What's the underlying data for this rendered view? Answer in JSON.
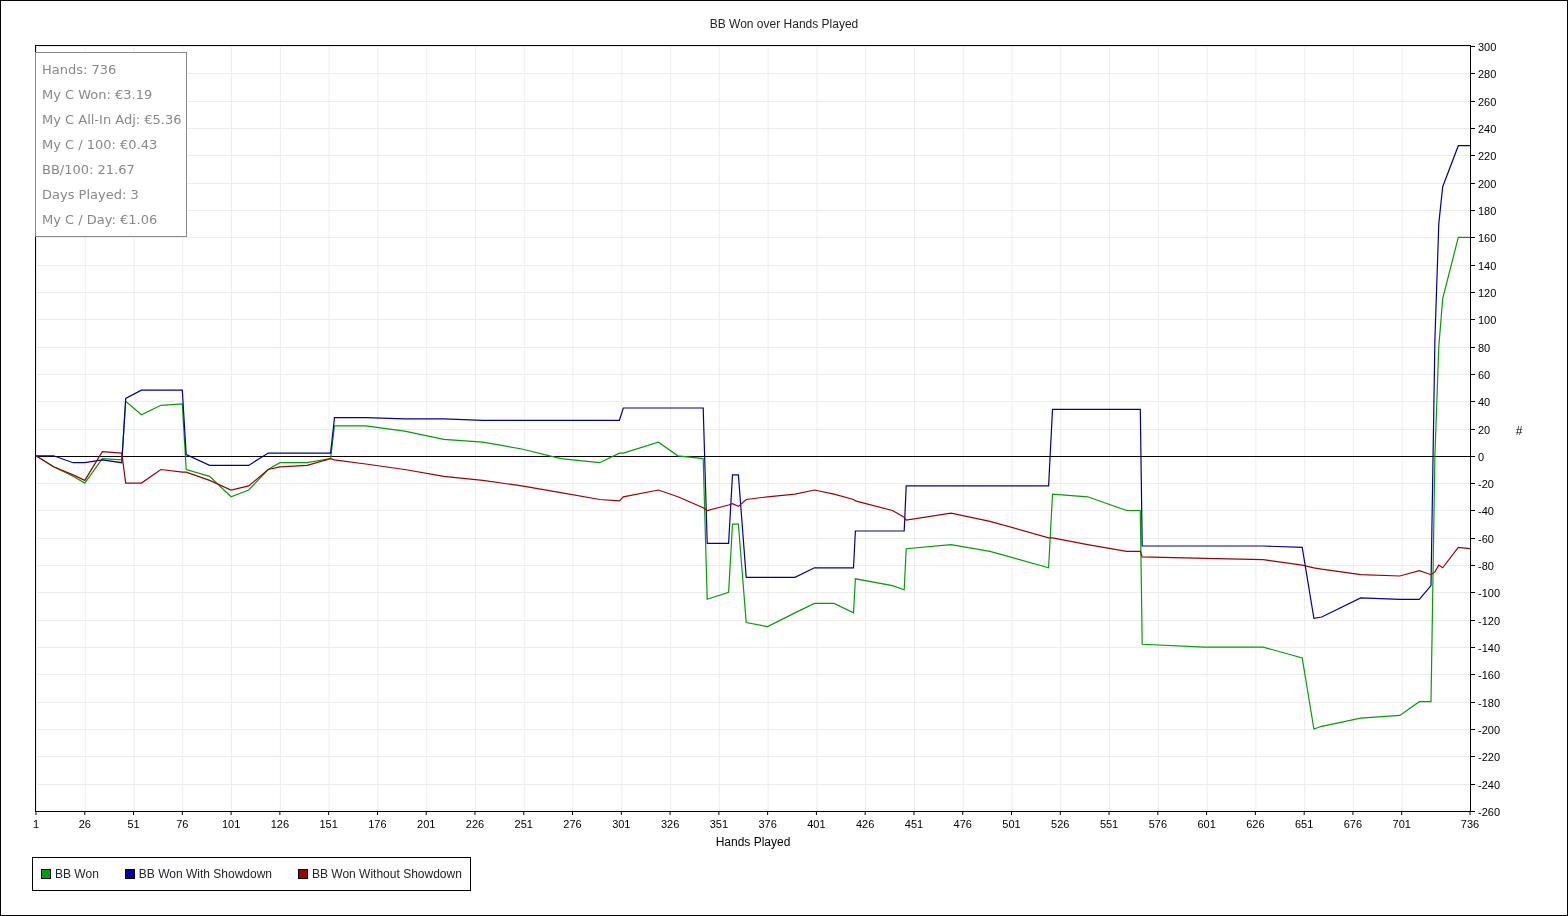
{
  "chart": {
    "stats": [
      "Hands: 736",
      "My C Won: €3.19",
      "My C All-In Adj: €5.36",
      "My C / 100: €0.43",
      "BB/100: 21.67",
      "Days Played: 3",
      "My C / Day: €1.06"
    ],
    "chart_data": {
      "type": "line",
      "title": "BB Won over Hands Played",
      "xlabel": "Hands Played",
      "ylabel": "#",
      "x": [
        1,
        10,
        20,
        26,
        35,
        45,
        47,
        55,
        65,
        76,
        78,
        90,
        101,
        110,
        120,
        126,
        140,
        152,
        154,
        170,
        190,
        210,
        230,
        250,
        270,
        290,
        300,
        302,
        320,
        330,
        343,
        345,
        356,
        358,
        361,
        365,
        376,
        390,
        400,
        410,
        420,
        421,
        440,
        446,
        447,
        470,
        490,
        520,
        522,
        540,
        560,
        567,
        568,
        600,
        630,
        650,
        656,
        660,
        680,
        700,
        710,
        716,
        718,
        720,
        722,
        730,
        736
      ],
      "series": [
        {
          "name": "BB Won",
          "color": "#00a000",
          "values": [
            0,
            -8,
            -15,
            -20,
            -2,
            -3,
            40,
            30,
            37,
            38,
            -10,
            -15,
            -30,
            -25,
            -10,
            -5,
            -5,
            -2,
            22,
            22,
            18,
            12,
            10,
            5,
            -2,
            -5,
            2,
            2,
            10,
            0,
            -2,
            -105,
            -100,
            -50,
            -50,
            -122,
            -125,
            -115,
            -108,
            -108,
            -115,
            -90,
            -95,
            -98,
            -68,
            -65,
            -70,
            -82,
            -28,
            -30,
            -40,
            -40,
            -138,
            -140,
            -140,
            -148,
            -200,
            -198,
            -192,
            -190,
            -180,
            -180,
            0,
            80,
            115,
            160,
            160
          ]
        },
        {
          "name": "BB Won With Showdown",
          "color": "#0000a0",
          "values": [
            0,
            0,
            -5,
            -5,
            -3,
            -5,
            42,
            48,
            48,
            48,
            1,
            -7,
            -7,
            -7,
            2,
            2,
            2,
            2,
            28,
            28,
            27,
            27,
            26,
            26,
            26,
            26,
            26,
            35,
            35,
            35,
            35,
            -64,
            -64,
            -14,
            -14,
            -89,
            -89,
            -89,
            -82,
            -82,
            -82,
            -55,
            -55,
            -55,
            -22,
            -22,
            -22,
            -22,
            34,
            34,
            34,
            34,
            -66,
            -66,
            -66,
            -67,
            -119,
            -118,
            -104,
            -105,
            -105,
            -95,
            85,
            170,
            197,
            227,
            227
          ]
        },
        {
          "name": "BB Won Without Showdown",
          "color": "#a00000",
          "values": [
            0,
            -8,
            -14,
            -18,
            3,
            2,
            -20,
            -20,
            -10,
            -12,
            -12,
            -18,
            -25,
            -22,
            -10,
            -8,
            -7,
            -2,
            -3,
            -6,
            -10,
            -15,
            -18,
            -22,
            -27,
            -32,
            -33,
            -30,
            -25,
            -30,
            -38,
            -40,
            -36,
            -35,
            -37,
            -32,
            -30,
            -28,
            -25,
            -28,
            -32,
            -33,
            -40,
            -45,
            -47,
            -42,
            -48,
            -60,
            -60,
            -65,
            -70,
            -70,
            -74,
            -75,
            -76,
            -80,
            -82,
            -83,
            -87,
            -88,
            -84,
            -87,
            -85,
            -80,
            -82,
            -67,
            -68
          ]
        }
      ],
      "grid": true,
      "xlim": [
        1,
        736
      ],
      "ylim": [
        -260,
        300
      ],
      "xticks": [
        1,
        26,
        51,
        76,
        101,
        126,
        151,
        176,
        201,
        226,
        251,
        276,
        301,
        326,
        351,
        376,
        401,
        426,
        451,
        476,
        501,
        526,
        551,
        576,
        601,
        626,
        651,
        676,
        701,
        736
      ],
      "yticks": [
        -260,
        -240,
        -220,
        -200,
        -180,
        -160,
        -140,
        -120,
        -100,
        -80,
        -60,
        -40,
        -20,
        0,
        20,
        40,
        60,
        80,
        100,
        120,
        140,
        160,
        180,
        200,
        220,
        240,
        260,
        280,
        300
      ]
    }
  }
}
